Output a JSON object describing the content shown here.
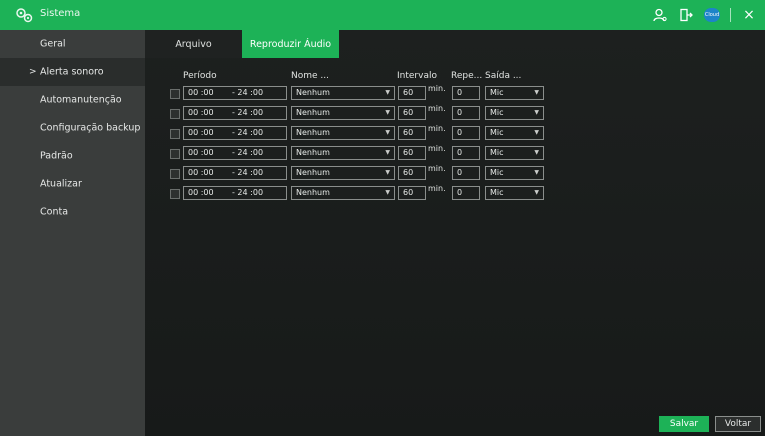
{
  "app": {
    "title": "Sistema"
  },
  "header_icons": [
    "user-icon",
    "logout-icon",
    "cloud-icon",
    "close-icon"
  ],
  "header": {
    "cloud_label": "Cloud",
    "close_glyph": "×"
  },
  "sidebar": {
    "items": [
      {
        "label": "Geral",
        "active": false
      },
      {
        "label": "Alerta sonoro",
        "active": true
      },
      {
        "label": "Automanutenção",
        "active": false
      },
      {
        "label": "Configuração backup",
        "active": false
      },
      {
        "label": "Padrão",
        "active": false
      },
      {
        "label": "Atualizar",
        "active": false
      },
      {
        "label": "Conta",
        "active": false
      }
    ],
    "active_marker": ">"
  },
  "tabs": [
    {
      "label": "Arquivo",
      "active": false
    },
    {
      "label": "Reproduzir Áudio",
      "active": true
    }
  ],
  "table": {
    "headers": {
      "period": "Período",
      "name": "Nome ...",
      "interval": "Intervalo",
      "repeat": "Repe...",
      "output": "Saída ..."
    },
    "rows": [
      {
        "checked": false,
        "start": "00 :00",
        "end": "- 24 :00",
        "name": "Nenhum",
        "interval": "60",
        "unit": "min.",
        "repeat": "0",
        "output": "Mic"
      },
      {
        "checked": false,
        "start": "00 :00",
        "end": "- 24 :00",
        "name": "Nenhum",
        "interval": "60",
        "unit": "min.",
        "repeat": "0",
        "output": "Mic"
      },
      {
        "checked": false,
        "start": "00 :00",
        "end": "- 24 :00",
        "name": "Nenhum",
        "interval": "60",
        "unit": "min.",
        "repeat": "0",
        "output": "Mic"
      },
      {
        "checked": false,
        "start": "00 :00",
        "end": "- 24 :00",
        "name": "Nenhum",
        "interval": "60",
        "unit": "min.",
        "repeat": "0",
        "output": "Mic"
      },
      {
        "checked": false,
        "start": "00 :00",
        "end": "- 24 :00",
        "name": "Nenhum",
        "interval": "60",
        "unit": "min.",
        "repeat": "0",
        "output": "Mic"
      },
      {
        "checked": false,
        "start": "00 :00",
        "end": "- 24 :00",
        "name": "Nenhum",
        "interval": "60",
        "unit": "min.",
        "repeat": "0",
        "output": "Mic"
      }
    ]
  },
  "buttons": {
    "save": "Salvar",
    "back": "Voltar"
  },
  "colors": {
    "accent": "#1db257",
    "sidebar_bg": "#3a3d3c",
    "main_bg": "#1a1d1c"
  }
}
